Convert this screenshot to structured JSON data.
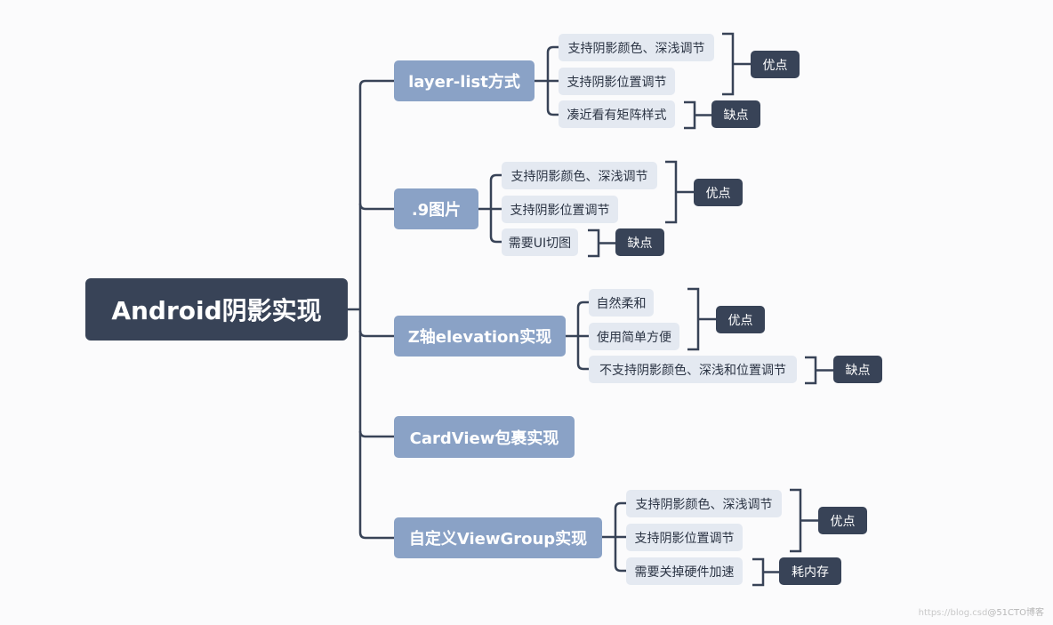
{
  "root": {
    "label": "Android阴影实现"
  },
  "colors": {
    "root": "#384357",
    "branch": "#8aa2c6",
    "leaf": "#e4e9f1",
    "tag": "#384357",
    "line": "#384357",
    "background": "#fbfbfc"
  },
  "branches": [
    {
      "label": "layer-list方式",
      "items": [
        "支持阴影颜色、深浅调节",
        "支持阴影位置调节",
        "凑近看有矩阵样式"
      ],
      "groups": [
        {
          "label": "优点",
          "covers": [
            0,
            1
          ]
        },
        {
          "label": "缺点",
          "covers": [
            2
          ]
        }
      ]
    },
    {
      "label": ".9图片",
      "items": [
        "支持阴影颜色、深浅调节",
        "支持阴影位置调节",
        "需要UI切图"
      ],
      "groups": [
        {
          "label": "优点",
          "covers": [
            0,
            1
          ]
        },
        {
          "label": "缺点",
          "covers": [
            2
          ]
        }
      ]
    },
    {
      "label": "Z轴elevation实现",
      "items": [
        "自然柔和",
        "使用简单方便",
        "不支持阴影颜色、深浅和位置调节"
      ],
      "groups": [
        {
          "label": "优点",
          "covers": [
            0,
            1
          ]
        },
        {
          "label": "缺点",
          "covers": [
            2
          ]
        }
      ]
    },
    {
      "label": "CardView包裹实现",
      "items": [],
      "groups": []
    },
    {
      "label": "自定义ViewGroup实现",
      "items": [
        "支持阴影颜色、深浅调节",
        "支持阴影位置调节",
        "需要关掉硬件加速"
      ],
      "groups": [
        {
          "label": "优点",
          "covers": [
            0,
            1
          ]
        },
        {
          "label": "耗内存",
          "covers": [
            2
          ]
        }
      ]
    }
  ],
  "watermark": {
    "url_text": "https://blog.csd",
    "site_text": "@51CTO博客"
  }
}
